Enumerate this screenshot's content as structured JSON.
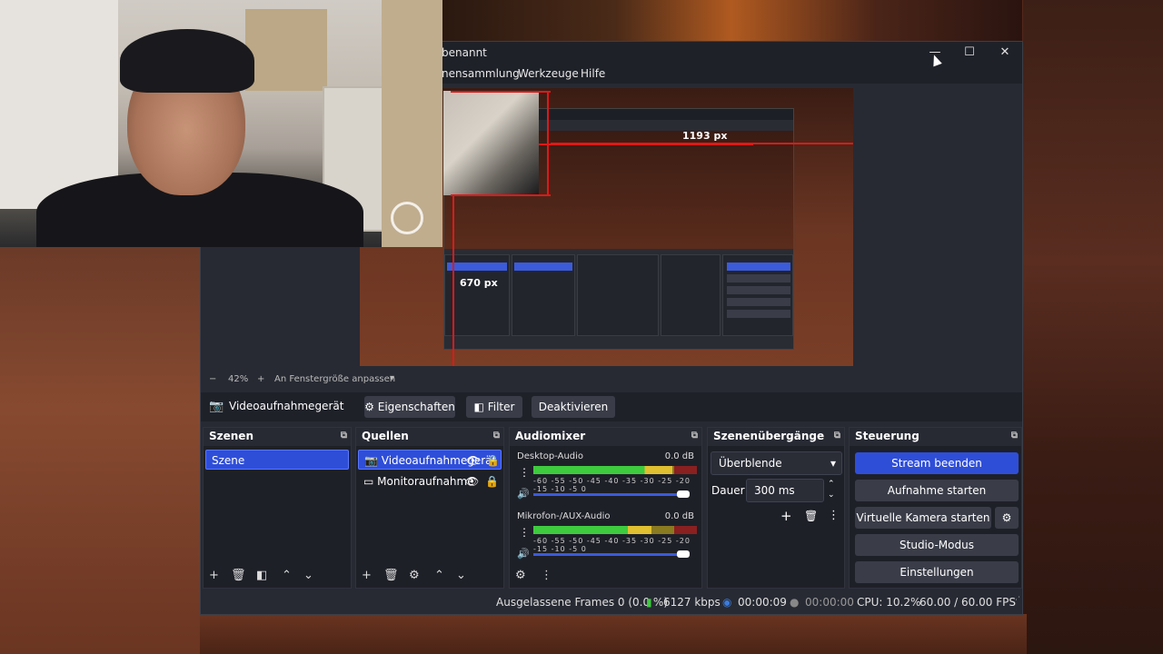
{
  "window": {
    "title": "benannt",
    "menu": [
      "nensammlung",
      "Werkzeuge",
      "Hilfe"
    ],
    "minimize": "—",
    "maximize": "☐",
    "close": "✕"
  },
  "preview": {
    "width_label": "1193 px",
    "height_label": "670 px"
  },
  "zoom": {
    "minus": "−",
    "value": "42%",
    "plus": "+",
    "fit_label": "An Fenstergröße anpassen",
    "caret": "▾"
  },
  "source_toolbar": {
    "source_name": "Videoaufnahmegerät",
    "properties": "Eigenschaften",
    "filter": "Filter",
    "deactivate": "Deaktivieren"
  },
  "scenes": {
    "title": "Szenen",
    "items": [
      "Szene"
    ]
  },
  "sources": {
    "title": "Quellen",
    "items": [
      "Videoaufnahmegerät",
      "Monitoraufnahme"
    ]
  },
  "mixer": {
    "title": "Audiomixer",
    "channels": [
      {
        "name": "Desktop-Audio",
        "db": "0.0 dB",
        "level": 0.85
      },
      {
        "name": "Mikrofon-/AUX-Audio",
        "db": "0.0 dB",
        "level": 0.72
      }
    ],
    "scale": "-60 -55 -50 -45 -40 -35 -30 -25 -20 -15 -10 -5 0"
  },
  "transitions": {
    "title": "Szenenübergänge",
    "selected": "Überblende",
    "duration_label": "Dauer",
    "duration_value": "300 ms"
  },
  "controls": {
    "title": "Steuerung",
    "stop_stream": "Stream beenden",
    "start_recording": "Aufnahme starten",
    "virtual_camera": "Virtuelle Kamera starten",
    "studio_mode": "Studio-Modus",
    "settings": "Einstellungen"
  },
  "status": {
    "dropped_frames": "Ausgelassene Frames 0 (0.0 %)",
    "bitrate": "6127 kbps",
    "stream_time": "00:00:09",
    "rec_time": "00:00:00",
    "cpu": "CPU: 10.2%",
    "fps": "60.00 / 60.00 FPS"
  }
}
